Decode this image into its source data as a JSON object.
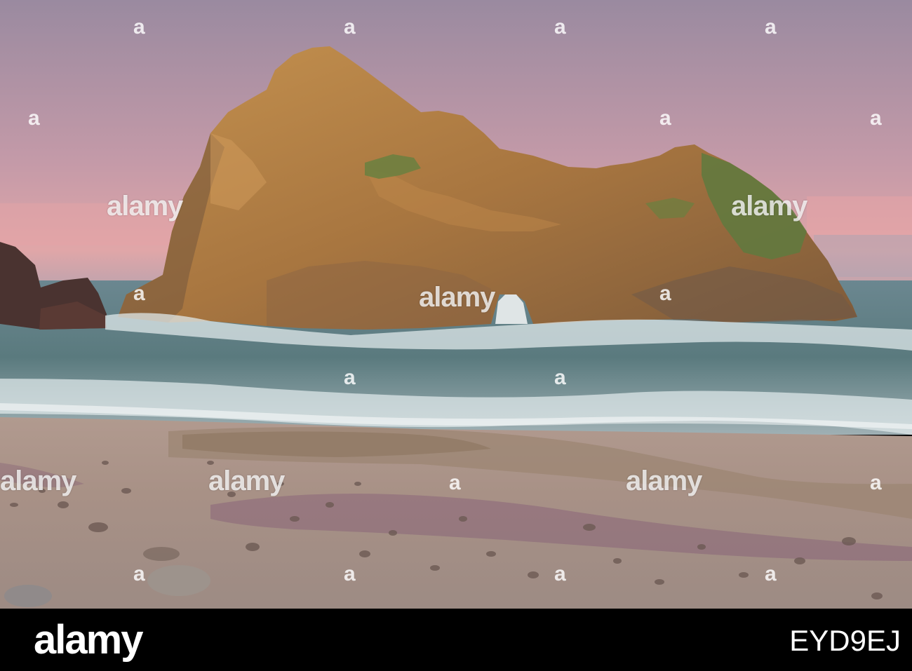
{
  "watermark": {
    "brand": "alamy",
    "mark": "a"
  },
  "footer": {
    "logo": "alamy",
    "image_id": "EYD9EJ"
  },
  "colors": {
    "sky_top": "#9d8aa0",
    "sky_horizon": "#e2a5a6",
    "rock": "#b07c42",
    "sea": "#5d7c80",
    "sand": "#a8958c",
    "footer_bg": "#000000"
  }
}
